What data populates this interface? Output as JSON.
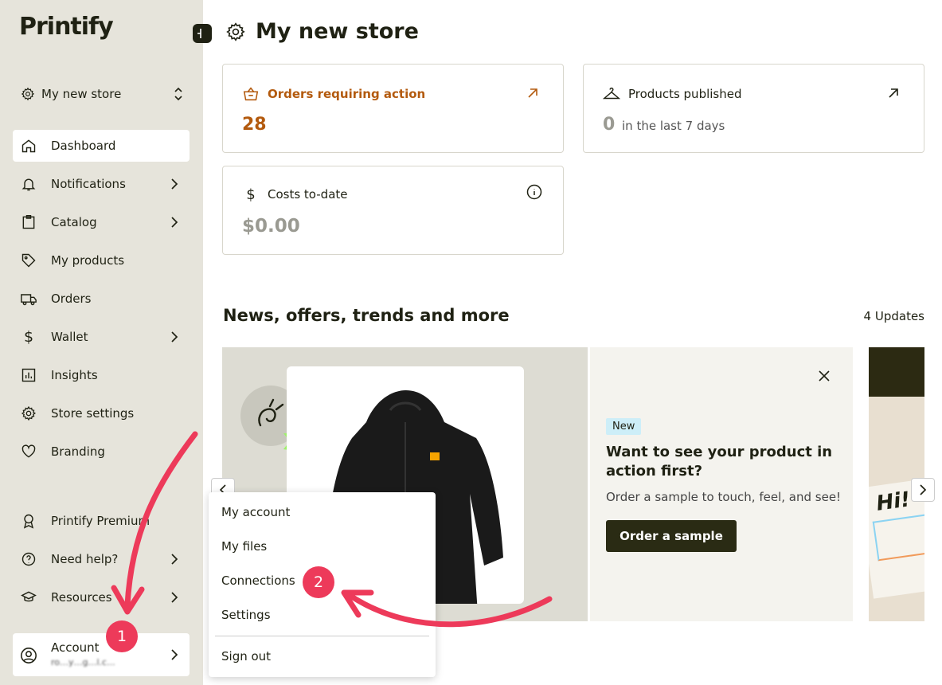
{
  "app": {
    "logo": "Printify"
  },
  "sidebar": {
    "store_name": "My new store",
    "items": [
      {
        "label": "Dashboard"
      },
      {
        "label": "Notifications"
      },
      {
        "label": "Catalog"
      },
      {
        "label": "My products"
      },
      {
        "label": "Orders"
      },
      {
        "label": "Wallet"
      },
      {
        "label": "Insights"
      },
      {
        "label": "Store settings"
      },
      {
        "label": "Branding"
      },
      {
        "label": "Printify Premium"
      },
      {
        "label": "Need help?"
      },
      {
        "label": "Resources"
      }
    ],
    "account": {
      "label": "Account",
      "email": "ro…y…g…l.c..."
    }
  },
  "main": {
    "title": "My new store",
    "cards": {
      "orders": {
        "label": "Orders requiring action",
        "value": "28"
      },
      "published": {
        "label": "Products published",
        "value": "0",
        "sub": "in the last 7 days"
      },
      "costs": {
        "label": "Costs to-date",
        "value": "$0.00"
      }
    },
    "news": {
      "title": "News, offers, trends and more",
      "updates": "4 Updates",
      "banner": {
        "tag": "New",
        "title": "Want to see your product in action first?",
        "subtitle": "Order a sample to touch, feel, and see!",
        "button": "Order a sample"
      },
      "banner2_text": "Hi!"
    }
  },
  "account_menu": {
    "items": [
      "My account",
      "My files",
      "Connections",
      "Settings",
      "Sign out"
    ]
  },
  "annotations": {
    "step1": "1",
    "step2": "2",
    "arrow_color": "#ed3a5a"
  },
  "colors": {
    "sidebar_bg": "#e6e4db",
    "accent_orange": "#b35a0e",
    "dark": "#1f2113"
  }
}
